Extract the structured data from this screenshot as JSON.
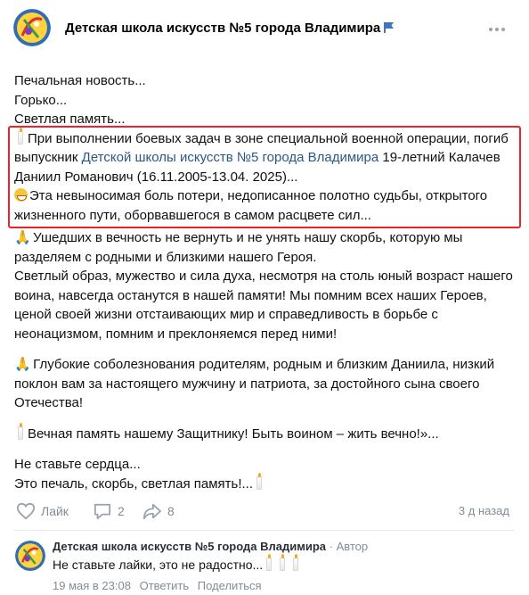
{
  "group": {
    "name": "Детская школа искусств №5 города Владимира"
  },
  "post": {
    "paragraphs": [
      {
        "lines": [
          "Печальная новость...",
          "Горько...",
          "Светлая память..."
        ]
      }
    ],
    "highlight": {
      "line1_text": "При выполнении боевых задач в зоне специальной военной операции, погиб выпускник ",
      "link_text": "Детской школы искусств №5 города Владимира",
      "line1_after": " 19-летний Калачев Даниил Романович (16.11.2005-13.04. 2025)...",
      "line2_text": "Эта невыносимая боль потери, недописанное полотно судьбы, открытого жизненного пути, оборвавшегося в самом расцвете сил..."
    },
    "para3": "Ушедших в вечность не вернуть и не унять нашу скорбь, которую мы разделяем с родными и близкими нашего Героя.",
    "para4": "Светлый образ, мужество и сила духа, несмотря на столь юный возраст нашего воина, навсегда останутся в нашей памяти! Мы помним всех наших Героев, ценой своей жизни отстаивающих мир и справедливость в борьбе с неонацизмом, помним и преклоняемся перед ними!",
    "para5": "Глубокие соболезнования родителям, родным и близким Даниила, низкий поклон вам за настоящего мужчину и патриота, за достойного сына своего Отечества!",
    "para6": "Вечная память нашему Защитнику! Быть воином – жить вечно!»...",
    "para7_line1": "Не ставьте сердца...",
    "para7_line2": "Это печаль, скорбь, светлая память!..."
  },
  "actions": {
    "like_label": "Лайк",
    "comments_count": "2",
    "shares_count": "8",
    "time_ago": "3 д назад"
  },
  "comment": {
    "author": "Детская школа искусств №5 города Владимира",
    "role": " · Автор",
    "text": "Не ставьте лайки, это не радостно...",
    "date": "19 мая в 23:08",
    "reply_label": "Ответить",
    "share_label": "Поделиться"
  },
  "colors": {
    "link": "#2a5885",
    "highlight_border": "#e8252f",
    "muted": "#818c99"
  },
  "icons": [
    "more-icon",
    "flag-icon",
    "like-icon",
    "comment-icon",
    "share-icon",
    "candle-icon",
    "grin-icon",
    "praying-hands-icon"
  ]
}
